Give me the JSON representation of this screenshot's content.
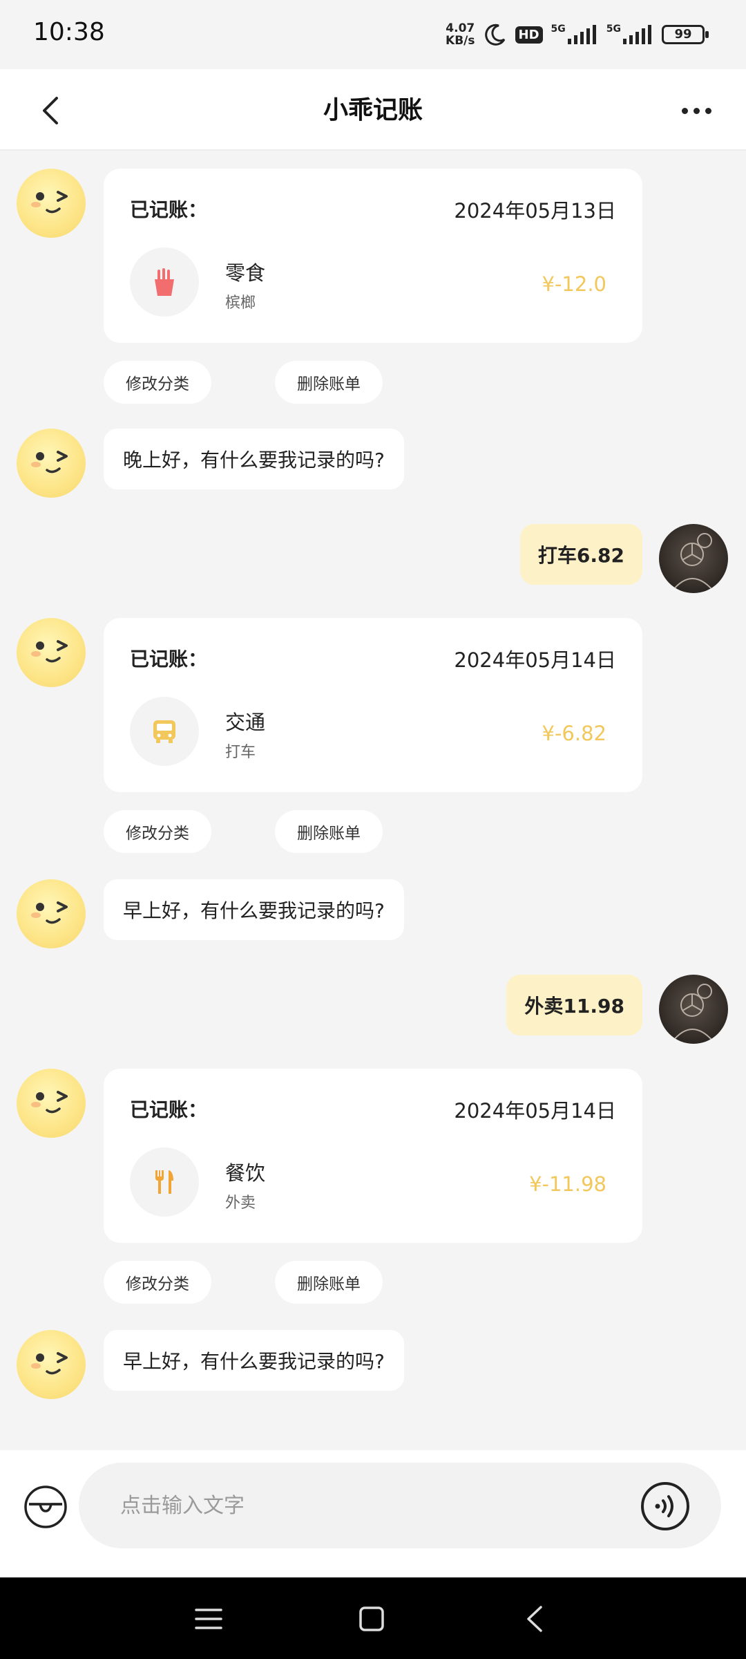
{
  "status_bar": {
    "time": "10:38",
    "net_speed_value": "4.07",
    "net_speed_unit": "KB/s",
    "hd_label": "HD",
    "sim1_label": "5G",
    "sim2_label": "5G",
    "battery": "99"
  },
  "header": {
    "title": "小乖记账"
  },
  "messages": {
    "card1": {
      "label": "已记账：",
      "date": "2024年05月13日",
      "category": "零食",
      "note": "槟榔",
      "amount": "¥-12.0",
      "icon": "fries-icon"
    },
    "card1_actions": {
      "edit": "修改分类",
      "delete": "删除账单"
    },
    "bot1": "晚上好，有什么要我记录的吗?",
    "user1": "打车6.82",
    "card2": {
      "label": "已记账：",
      "date": "2024年05月14日",
      "category": "交通",
      "note": "打车",
      "amount": "¥-6.82",
      "icon": "bus-icon"
    },
    "card2_actions": {
      "edit": "修改分类",
      "delete": "删除账单"
    },
    "bot2": "早上好，有什么要我记录的吗?",
    "user2": "外卖11.98",
    "card3": {
      "label": "已记账：",
      "date": "2024年05月14日",
      "category": "餐饮",
      "note": "外卖",
      "amount": "¥-11.98",
      "icon": "utensils-icon"
    },
    "card3_actions": {
      "edit": "修改分类",
      "delete": "删除账单"
    },
    "bot3": "早上好，有什么要我记录的吗?"
  },
  "input": {
    "placeholder": "点击输入文字"
  },
  "colors": {
    "amount": "#f2c75c",
    "user_bubble": "#fdf1c8",
    "bot_avatar": "#fde68a"
  }
}
